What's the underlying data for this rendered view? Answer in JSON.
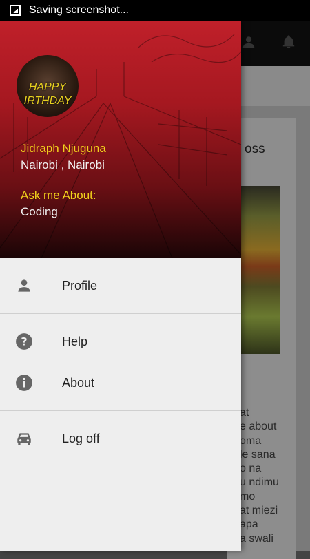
{
  "status_bar": {
    "notification_text": "Saving screenshot..."
  },
  "background": {
    "partial_title": "oss",
    "partial_text_lines": [
      "at",
      "e about",
      "oma",
      "le sana",
      "o na",
      "u ndimu",
      "mo",
      "at miezi",
      "apa",
      "a swali"
    ]
  },
  "drawer": {
    "avatar_text_line1": "HAPPY",
    "avatar_text_line2": "IRTHDAY",
    "user_name": "Jidraph Njuguna",
    "location": "Nairobi , Nairobi",
    "ask_label": "Ask me About:",
    "ask_value": "Coding",
    "items": [
      {
        "label": "Profile",
        "icon": "person-icon"
      },
      {
        "label": "Help",
        "icon": "help-icon"
      },
      {
        "label": "About",
        "icon": "info-icon"
      },
      {
        "label": "Log off",
        "icon": "car-icon"
      }
    ]
  },
  "colors": {
    "accent_yellow": "#f2d21c",
    "header_red": "#c0202a"
  }
}
